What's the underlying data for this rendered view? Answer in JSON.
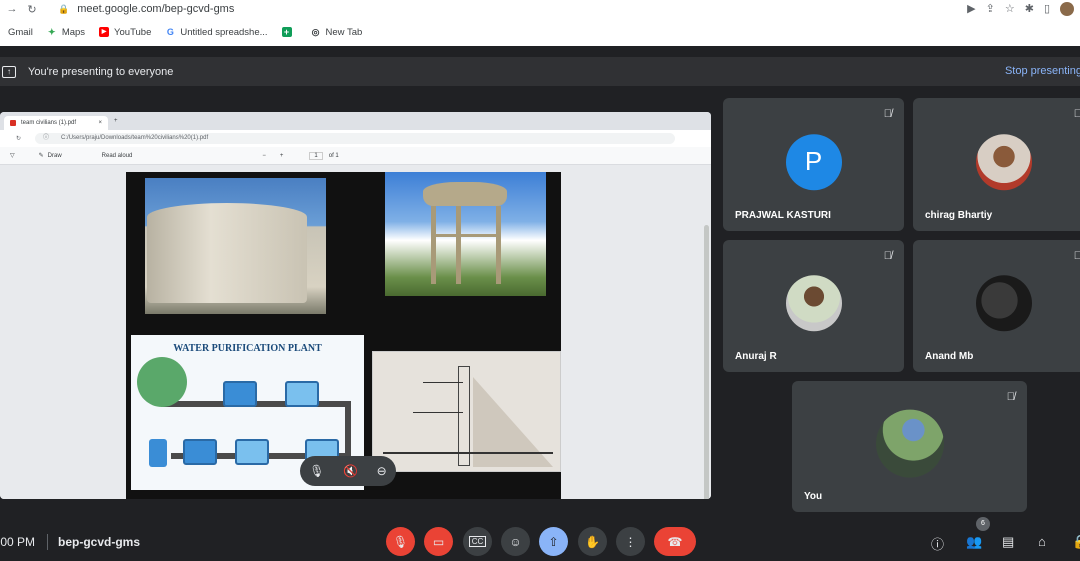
{
  "browser": {
    "url": "meet.google.com/bep-gcvd-gms",
    "bookmarks": [
      {
        "label": "Gmail",
        "icon": "gmail-icon"
      },
      {
        "label": "Maps",
        "icon": "maps-icon"
      },
      {
        "label": "YouTube",
        "icon": "youtube-icon"
      },
      {
        "label": "Untitled spreadshe...",
        "icon": "google-icon"
      },
      {
        "label": "",
        "icon": "sheets-icon"
      },
      {
        "label": "New Tab",
        "icon": "globe-icon"
      }
    ]
  },
  "meet": {
    "presenting_text": "You're presenting to everyone",
    "stop_label": "Stop presenting",
    "time": ":00 PM",
    "meeting_code": "bep-gcvd-gms",
    "people_count": "6"
  },
  "shared_screen": {
    "tab_title": "team civilians (1).pdf",
    "file_path": "C:/Users/praju/Downloads/team%20civilians%20(1).pdf",
    "draw_label": "Draw",
    "read_aloud_label": "Read aloud",
    "page_number": "1",
    "page_total": "of 1",
    "slide_title": "WATER PURIFICATION PLANT"
  },
  "participants": [
    {
      "name": "PRAJWAL KASTURI",
      "initial": "P",
      "muted": true
    },
    {
      "name": "chirag Bhartiy",
      "muted": true
    },
    {
      "name": "Anuraj R",
      "muted": true
    },
    {
      "name": "Anand Mb",
      "muted": true
    },
    {
      "name": "You",
      "muted": true
    }
  ],
  "colors": {
    "accent_blue": "#8ab4f8",
    "mic_off_red": "#ea4335",
    "avatar_blue": "#1e88e5",
    "tile_bg": "#3c4043"
  }
}
